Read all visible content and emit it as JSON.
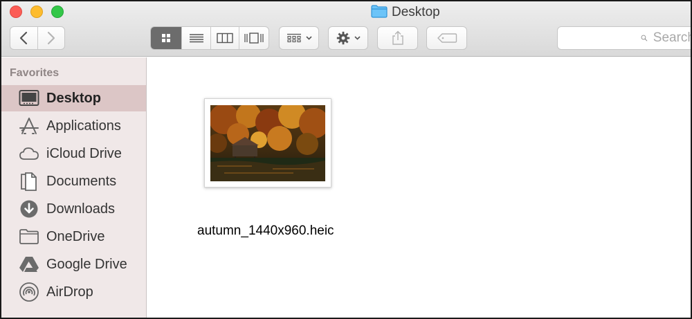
{
  "window": {
    "title": "Desktop",
    "title_icon": "folder-icon",
    "traffic_lights": {
      "close": "#fc5d56",
      "minimize": "#fdbc2e",
      "zoom": "#33c748"
    }
  },
  "toolbar": {
    "back_icon": "chevron-left-icon",
    "forward_icon": "chevron-right-icon",
    "view_modes": [
      "icon-view",
      "list-view",
      "column-view",
      "cover-flow-view"
    ],
    "active_view": "icon-view",
    "arrange_icon": "arrange-grid-icon",
    "action_icon": "gear-icon",
    "share_icon": "share-icon",
    "tags_icon": "tag-icon",
    "search_placeholder": "Search"
  },
  "sidebar": {
    "heading": "Favorites",
    "items": [
      {
        "label": "Desktop",
        "icon": "desktop-icon",
        "selected": true
      },
      {
        "label": "Applications",
        "icon": "applications-icon",
        "selected": false
      },
      {
        "label": "iCloud Drive",
        "icon": "cloud-icon",
        "selected": false
      },
      {
        "label": "Documents",
        "icon": "documents-icon",
        "selected": false
      },
      {
        "label": "Downloads",
        "icon": "downloads-icon",
        "selected": false
      },
      {
        "label": "OneDrive",
        "icon": "folder-icon",
        "selected": false
      },
      {
        "label": "Google Drive",
        "icon": "google-drive-icon",
        "selected": false
      },
      {
        "label": "AirDrop",
        "icon": "airdrop-icon",
        "selected": false
      }
    ]
  },
  "content": {
    "files": [
      {
        "name": "autumn_1440x960.heic",
        "thumbnail": "autumn-lake-boathouse-photo"
      }
    ]
  },
  "colors": {
    "sidebar_bg": "#f0e8e8",
    "sidebar_selected": "#dcc6c6",
    "toolbar_gradient_top": "#eeeeee",
    "toolbar_gradient_bottom": "#d9d9d9",
    "title_folder_accent": "#3fa9f5"
  }
}
